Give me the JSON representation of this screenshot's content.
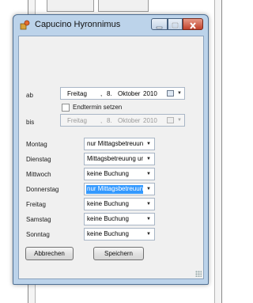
{
  "window": {
    "title": "Capucino Hyronnimus",
    "app_icon": "app-icon"
  },
  "controls": {
    "minimize_icon": "minimize-icon",
    "maximize_icon": "maximize-icon",
    "close_icon": "close-icon"
  },
  "form": {
    "ab_label": "ab",
    "start_date": {
      "weekday": "Freitag",
      "day": "8.",
      "month": "Oktober",
      "year": "2010"
    },
    "end_checkbox": {
      "label": "Endtermin setzen",
      "checked": false
    },
    "bis_label": "bis",
    "end_date": {
      "weekday": "Freitag",
      "day": "8.",
      "month": "Oktober",
      "year": "2010",
      "enabled": false
    },
    "days": [
      {
        "day": "Montag",
        "value": "nur Mittagsbetreuung",
        "selected": false
      },
      {
        "day": "Dienstag",
        "value": "Mittagsbetreuung und",
        "selected": false
      },
      {
        "day": "Mittwoch",
        "value": "keine Buchung",
        "selected": false
      },
      {
        "day": "Donnerstag",
        "value": "nur Mittagsbetreuung",
        "selected": true
      },
      {
        "day": "Freitag",
        "value": "keine Buchung",
        "selected": false
      },
      {
        "day": "Samstag",
        "value": "keine Buchung",
        "selected": false
      },
      {
        "day": "Sonntag",
        "value": "keine Buchung",
        "selected": false
      }
    ],
    "cancel_label": "Abbrechen",
    "save_label": "Speichern"
  },
  "colors": {
    "accent": "#3399ff",
    "window_frame": "#bcd3ea",
    "close_button": "#c1412b"
  }
}
